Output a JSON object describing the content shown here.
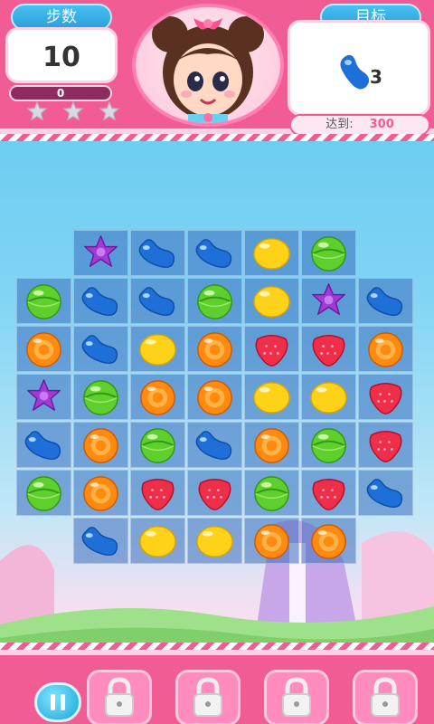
{
  "hud": {
    "moves_label": "步数",
    "moves_value": "10",
    "score_value": "0",
    "stars_total": 3,
    "target_label": "目标",
    "target_icon": "blue-jelly-bean-icon",
    "target_count": "3",
    "reach_label": "达到:",
    "reach_value": "300"
  },
  "board": {
    "rows": [
      [
        null,
        "purple",
        "blue",
        "blue",
        "yellow",
        "green",
        null
      ],
      [
        "green",
        "blue",
        "blue",
        "green",
        "yellow",
        "purple",
        "blue"
      ],
      [
        "orange",
        "blue",
        "yellow",
        "orange",
        "red",
        "red",
        "orange"
      ],
      [
        "purple",
        "green",
        "orange",
        "orange",
        "yellow",
        "yellow",
        "red"
      ],
      [
        "blue",
        "orange",
        "green",
        "blue",
        "orange",
        "green",
        "red"
      ],
      [
        "green",
        "orange",
        "red",
        "red",
        "green",
        "red",
        "blue"
      ],
      [
        null,
        "blue",
        "yellow",
        "yellow",
        "orange",
        "orange",
        null
      ]
    ]
  },
  "bottom": {
    "pause_icon": "pause-icon",
    "slots": [
      "lock-icon",
      "lock-icon",
      "lock-icon",
      "lock-icon"
    ]
  },
  "colors": {
    "accent_pink": "#f25c95",
    "accent_blue": "#2a9fd8"
  }
}
